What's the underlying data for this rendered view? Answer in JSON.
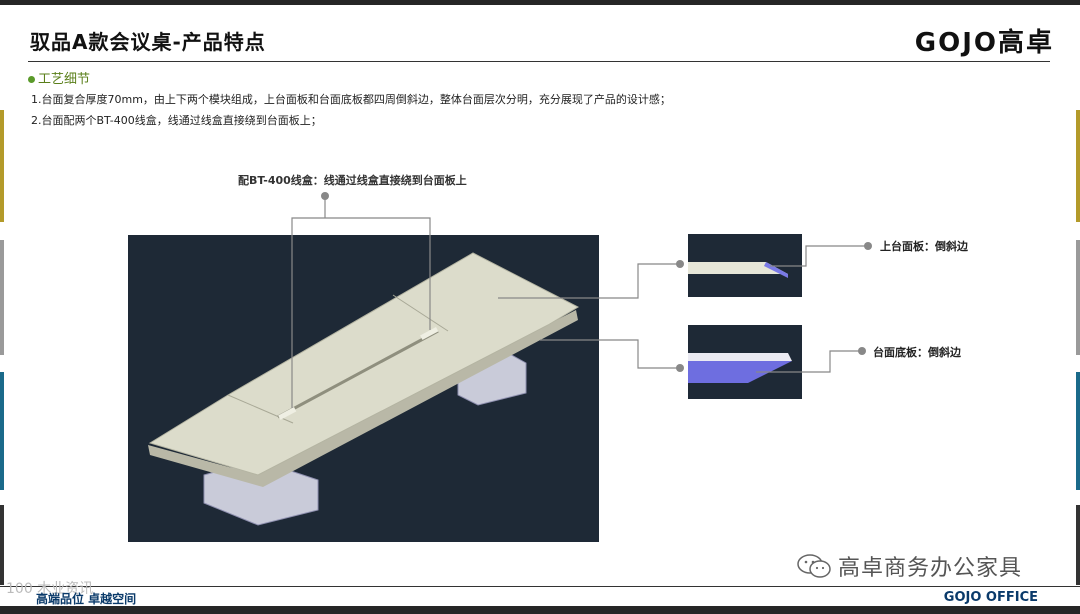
{
  "header": {
    "title": "驭品A款会议桌-产品特点",
    "logo": "GOJO高卓"
  },
  "section": {
    "heading": "工艺细节",
    "bullets": [
      "1.台面复合厚度70mm，由上下两个模块组成，上台面板和台面底板都四周倒斜边，整体台面层次分明，充分展现了产品的设计感；",
      "2.台面配两个BT-400线盒，线通过线盒直接绕到台面板上；"
    ]
  },
  "callouts": {
    "top": "配BT-400线盒：线通过线盒直接绕到台面板上",
    "top_panel": "上台面板：倒斜边",
    "bottom_panel": "台面底板：倒斜边"
  },
  "footer": {
    "left": "高端品位 卓越空间",
    "right": "GOJO OFFICE"
  },
  "watermark": {
    "text": "高卓商务办公家具",
    "left_text": "100 木业资讯"
  },
  "colors": {
    "panel_bg": "#1e2936",
    "table_top": "#dcdccb",
    "accent_green": "#5a7f1a",
    "footer_blue": "#0a3a6a",
    "bevel_violet": "#6e6ee0"
  }
}
